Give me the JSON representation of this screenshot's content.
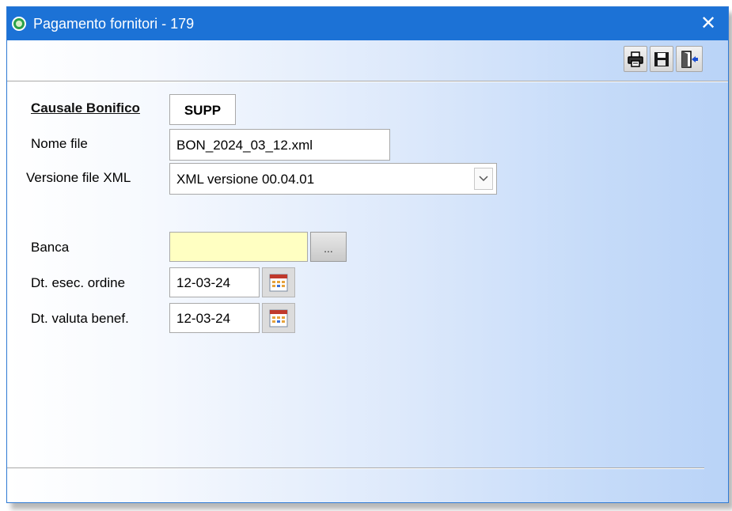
{
  "window": {
    "title": "Pagamento fornitori - 179",
    "close_symbol": "✕"
  },
  "toolbar": {
    "buttons": [
      "print-icon",
      "save-icon",
      "exit-icon"
    ]
  },
  "form": {
    "causale": {
      "label": "Causale Bonifico",
      "value": "SUPP"
    },
    "nome_file": {
      "label": "Nome file",
      "value": "BON_2024_03_12.xml"
    },
    "versione": {
      "label": "Versione file XML",
      "selected": "XML versione 00.04.01"
    },
    "banca": {
      "label": "Banca",
      "value": "",
      "button_label": "..."
    },
    "dt_esec": {
      "label": "Dt. esec. ordine",
      "value": "12-03-24"
    },
    "dt_valuta": {
      "label": "Dt. valuta benef.",
      "value": "12-03-24"
    }
  },
  "colors": {
    "titlebar": "#1c72d6",
    "banca_field": "#ffffc2",
    "border": "#2f7ad4"
  }
}
